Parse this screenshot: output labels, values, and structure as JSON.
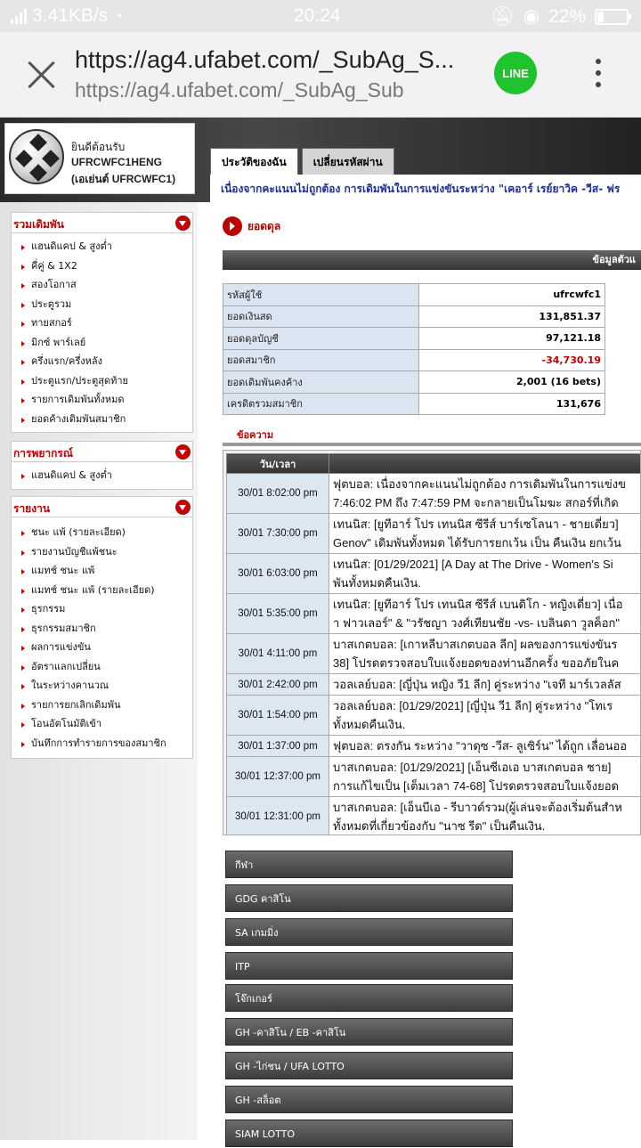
{
  "status": {
    "speed": "3.41KB/s",
    "time": "20:24",
    "battery": "22%"
  },
  "browser": {
    "title": "https://ag4.ufabet.com/_SubAg_S...",
    "url": "https://ag4.ufabet.com/_SubAg_Sub",
    "line_label": "LINE"
  },
  "header": {
    "welcome": "ยินดีต้อนรับ",
    "user": "UFRCWFC1HENG",
    "agent": "(เอเย่นต์  UFRCWFC1)",
    "tabs": [
      "ประวัติของฉัน",
      "เปลี่ยนรหัสผ่าน"
    ],
    "marquee": "เนื่องจากคะแนนไม่ถูกต้อง การเดิมพันในการแข่งขันระหว่าง \"เคอาร์ เรย์ยาวิค -วีส- ฟร"
  },
  "sidebar": {
    "sections": [
      {
        "title": "รวมเดิมพัน",
        "items": [
          "แฮนดิแคป & สูงต่ำ",
          "คี่คู่ & 1X2",
          "สองโอกาส",
          "ประตูรวม",
          "ทายสกอร์",
          "มิกซ์ พาร์เลย์",
          "ครึ่งแรก/ครึ่งหลัง",
          "ประตูแรก/ประตูสุดท้าย",
          "รายการเดิมพันทั้งหมด",
          "ยอดค้างเดิมพันสมาชิก"
        ]
      },
      {
        "title": "การพยากรณ์",
        "items": [
          "แฮนดิแคป & สูงต่ำ"
        ]
      },
      {
        "title": "รายงาน",
        "items": [
          "ชนะ แพ้ (รายละเอียด)",
          "รายงานบัญชีแพ้ชนะ",
          "แมทช์ ชนะ แพ้",
          "แมทช์ ชนะ แพ้ (รายละเอียด)",
          "ธุรกรรม",
          "ธุรกรรมสมาชิก",
          "ผลการแข่งขัน",
          "อัตราแลกเปลี่ยน",
          "ในระหว่างคานวณ",
          "รายการยกเลิกเดิมพัน",
          "โอนอัตโนมัติเข้า",
          "บันทึกการทำรายการของสมาชิก"
        ]
      }
    ]
  },
  "main": {
    "balance_title": "ยอดดุล",
    "info_header": "ข้อมูลตัวแ",
    "info_rows": [
      {
        "label": "รหัสผู้ใช้",
        "value": "ufrcwfc1"
      },
      {
        "label": "ยอดเงินสด",
        "value": "131,851.37"
      },
      {
        "label": "ยอดดุลบัญชี",
        "value": "97,121.18"
      },
      {
        "label": "ยอดสมาชิก",
        "value": "-34,730.19"
      },
      {
        "label": "ยอดเดิมพันคงค้าง",
        "value": "2,001 (16 bets)"
      },
      {
        "label": "เครดิตรวมสมาชิก",
        "value": "131,676"
      }
    ],
    "messages_label": "ข้อความ",
    "messages_header": "วัน/เวลา",
    "messages": [
      {
        "time": "30/01 8:02:00 pm",
        "lines": [
          "ฟุตบอล: เนื่องจากคะแนนไม่ถูกต้อง การเดิมพันในการแข่งข",
          "7:46:02 PM ถึง 7:47:59 PM จะกลายเป็นโมฆะ สกอร์ที่เกิด"
        ]
      },
      {
        "time": "30/01 7:30:00 pm",
        "lines": [
          "เทนนิส: [ยูทีอาร์ โปร เทนนิส ซีรีส์ บาร์เซโลนา - ชายเดี่ยว]",
          "Genov\" เดิมพันทั้งหมด ได้รับการยกเว้น เป็น คืนเงิน ยกเว้น"
        ]
      },
      {
        "time": "30/01 6:03:00 pm",
        "lines": [
          "เทนนิส: [01/29/2021] [A Day at The Drive - Women's Si",
          "พันทั้งหมดคืนเงิน."
        ]
      },
      {
        "time": "30/01 5:35:00 pm",
        "lines": [
          "เทนนิส: [ยูทีอาร์ โปร เทนนิส ซีรีส์ เบนดิโก - หญิงเดี่ยว] เนื่อ",
          "า ฟาวเลอร์\" & \"วรัชญา วงศ์เทียนชัย -vs- เบลินดา วูลค็อก\""
        ]
      },
      {
        "time": "30/01 4:11:00 pm",
        "lines": [
          "บาสเกตบอล: [เกาหลีบาสเกตบอล ลีก] ผลของการแข่งขันร",
          "38] โปรดตรวจสอบใบแจ้งยอดของท่านอีกครั้ง ขออภัยในค"
        ]
      },
      {
        "time": "30/01 2:42:00 pm",
        "lines": [
          "วอลเลย์บอล: [ญี่ปุ่น หญิง วี1 ลีก] คู่ระหว่าง \"เจที มาร์เวลลัส"
        ]
      },
      {
        "time": "30/01 1:54:00 pm",
        "lines": [
          "วอลเลย์บอล: [01/29/2021] [ญี่ปุ่น วี1 ลีก] คู่ระหว่าง \"โทเร",
          "ทั้งหมดคืนเงิน."
        ]
      },
      {
        "time": "30/01 1:37:00 pm",
        "lines": [
          "ฟุตบอล: ตรงกัน ระหว่าง \"วาดุซ -วีส- ลูเซิร์น\" ได้ถูก เลื่อนออ"
        ]
      },
      {
        "time": "30/01 12:37:00 pm",
        "lines": [
          "บาสเกตบอล: [01/29/2021] [เอ็นซีเอเอ บาสเกตบอล ชาย]",
          "การแก้ไขเป็น [เต็มเวลา 74-68] โปรดตรวจสอบใบแจ้งยอด"
        ]
      },
      {
        "time": "30/01 12:31:00 pm",
        "lines": [
          "บาสเกตบอล: [เอ็นบีเอ - รีบาวด์รวม(ผู้เล่นจะต้องเริ่มต้นสำห",
          "ทั้งหมดที่เกี่ยวข้องกับ \"นาซ รีด\" เป็นคืนเงิน."
        ]
      }
    ],
    "game_buttons": [
      "กีฬา",
      "GDG คาสิโน",
      "SA เกมมิ่ง",
      "ITP",
      "โจ๊กเกอร์",
      "GH -คาสิโน / EB -คาสิโน",
      "GH -ไก่ชน / UFA LOTTO",
      "GH -สล็อต",
      "SIAM LOTTO"
    ]
  },
  "colors": {
    "accent_red": "#c40000",
    "link_blue": "#1a2fa0",
    "label_bg": "#dbe5f1"
  }
}
